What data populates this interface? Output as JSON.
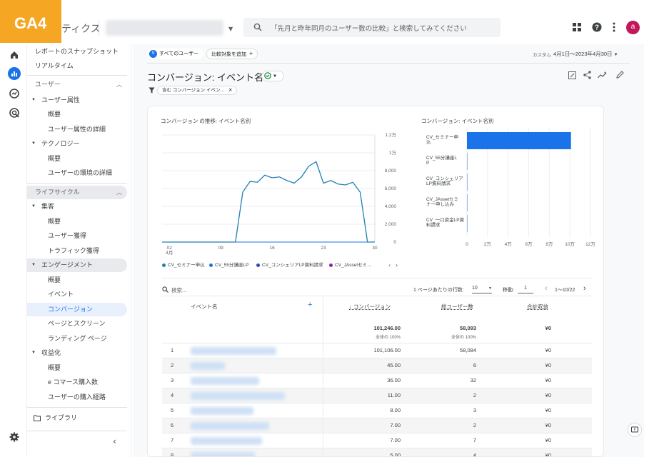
{
  "header": {
    "badge": "GA4",
    "app_title": "ティクス",
    "search_placeholder": "「先月と昨年同月のユーザー数の比較」と検索してみてください",
    "avatar_letter": "a"
  },
  "sidebar": {
    "items": [
      {
        "label": "レポートのスナップショット",
        "type": "item",
        "indent": 0
      },
      {
        "label": "リアルタイム",
        "type": "item",
        "indent": 0
      },
      {
        "label": "ユーザー",
        "type": "section"
      },
      {
        "label": "ユーザー属性",
        "type": "group"
      },
      {
        "label": "概要",
        "type": "item",
        "indent": 2
      },
      {
        "label": "ユーザー属性の詳細",
        "type": "item",
        "indent": 2
      },
      {
        "label": "テクノロジー",
        "type": "group"
      },
      {
        "label": "概要",
        "type": "item",
        "indent": 2
      },
      {
        "label": "ユーザーの環境の詳細",
        "type": "item",
        "indent": 2
      },
      {
        "label": "ライフサイクル",
        "type": "section"
      },
      {
        "label": "集客",
        "type": "group"
      },
      {
        "label": "概要",
        "type": "item",
        "indent": 2
      },
      {
        "label": "ユーザー獲得",
        "type": "item",
        "indent": 2
      },
      {
        "label": "トラフィック獲得",
        "type": "item",
        "indent": 2
      },
      {
        "label": "エンゲージメント",
        "type": "group"
      },
      {
        "label": "概要",
        "type": "item",
        "indent": 2
      },
      {
        "label": "イベント",
        "type": "item",
        "indent": 2
      },
      {
        "label": "コンバージョン",
        "type": "item",
        "indent": 2
      },
      {
        "label": "ページとスクリーン",
        "type": "item",
        "indent": 2
      },
      {
        "label": "ランディング ページ",
        "type": "item",
        "indent": 2
      },
      {
        "label": "収益化",
        "type": "group"
      },
      {
        "label": "概要",
        "type": "item",
        "indent": 2
      },
      {
        "label": "e コマース購入数",
        "type": "item",
        "indent": 2
      },
      {
        "label": "ユーザーの購入経路",
        "type": "item",
        "indent": 2
      }
    ],
    "library": "ライブラリ"
  },
  "filters": {
    "all_users": "すべてのユーザー",
    "add_comparison": "比較対象を追加",
    "date_prefix": "カスタム",
    "date_range": "4月1日～2023年4月30日",
    "filter_chip": "含む コンバージョン イベン…"
  },
  "page": {
    "title": "コンバージョン: イベント名"
  },
  "chart_data": [
    {
      "type": "line",
      "title": "コンバージョン の推移: イベント名別",
      "x_ticks": [
        "02\n4月",
        "09",
        "16",
        "23",
        "30"
      ],
      "y_ticks": [
        "0",
        "2,000",
        "4,000",
        "6,000",
        "8,000",
        "1万",
        "1.2万"
      ],
      "ylim": [
        0,
        12000
      ],
      "x": [
        1,
        2,
        3,
        4,
        5,
        6,
        7,
        8,
        9,
        10,
        11,
        12,
        13,
        14,
        15,
        16,
        17,
        18,
        19,
        20,
        21,
        22,
        23,
        24,
        25,
        26,
        27,
        28,
        29,
        30
      ],
      "series": [
        {
          "name": "CV_セミナー申込",
          "color": "#1f7fb5",
          "values": [
            0,
            0,
            0,
            0,
            0,
            0,
            0,
            0,
            0,
            0,
            0,
            5600,
            6800,
            6700,
            7500,
            7200,
            7300,
            6900,
            6600,
            7300,
            8500,
            9000,
            6600,
            6900,
            6500,
            6400,
            6700,
            5600,
            0,
            0
          ]
        },
        {
          "name": "CV_55分講座LP",
          "color": "#1a73e8",
          "values": [
            0,
            0,
            0,
            0,
            0,
            0,
            0,
            0,
            0,
            0,
            0,
            0,
            0,
            0,
            0,
            0,
            0,
            0,
            0,
            0,
            0,
            0,
            0,
            0,
            0,
            0,
            0,
            0,
            0,
            0
          ]
        },
        {
          "name": "CV_コンシェリアLP資料請求",
          "color": "#3949ab",
          "values": [
            0,
            0,
            0,
            0,
            0,
            0,
            0,
            0,
            0,
            0,
            0,
            0,
            0,
            0,
            0,
            0,
            0,
            0,
            0,
            0,
            0,
            0,
            0,
            0,
            0,
            0,
            0,
            0,
            0,
            0
          ]
        },
        {
          "name": "CV_JAssetセミ…",
          "color": "#8e24aa",
          "values": [
            0,
            0,
            0,
            0,
            0,
            0,
            0,
            0,
            0,
            0,
            0,
            0,
            0,
            0,
            0,
            0,
            0,
            0,
            0,
            0,
            0,
            0,
            0,
            0,
            0,
            0,
            0,
            0,
            0,
            0
          ]
        }
      ]
    },
    {
      "type": "bar",
      "orientation": "horizontal",
      "title": "コンバージョン: イベント名別",
      "categories": [
        "CV_セミナー申込",
        "CV_55分講座LP",
        "CV_コンシェリアLP資料請求",
        "CV_JAssetセミナー申し込み",
        "CV_一口资金LP資料請求"
      ],
      "category_labels": [
        [
          "CV_セミナー申",
          "込"
        ],
        [
          "CV_55分講座L",
          "P"
        ],
        [
          "CV_コンシェリア",
          "LP資料請求"
        ],
        [
          "CV_JAssetセミ",
          "ナー申し込み"
        ],
        [
          "CV_一口资金LP資",
          "料請求"
        ]
      ],
      "values": [
        101106,
        45,
        36,
        11,
        8
      ],
      "x_ticks": [
        "0",
        "2万",
        "4万",
        "6万",
        "8万",
        "10万",
        "12万"
      ],
      "xlim": [
        0,
        120000
      ],
      "color": "#1a73e8"
    }
  ],
  "table": {
    "search_placeholder": "検索...",
    "rows_per_page_label": "1 ページあたりの行数:",
    "rows_per_page": "10",
    "goto_label": "移動:",
    "goto_value": "1",
    "pagination": "1～10/22",
    "columns": [
      "イベント名",
      "↓ コンバージョン",
      "総ユーザー数",
      "合計収益"
    ],
    "totals": {
      "conversions": "101,246.00",
      "users": "58,093",
      "revenue": "¥0",
      "pct_label": "全体の 100%"
    },
    "rows": [
      {
        "idx": "1",
        "conversions": "101,106.00",
        "users": "58,084",
        "revenue": "¥0"
      },
      {
        "idx": "2",
        "conversions": "45.00",
        "users": "6",
        "revenue": "¥0"
      },
      {
        "idx": "3",
        "conversions": "36.00",
        "users": "32",
        "revenue": "¥0"
      },
      {
        "idx": "4",
        "conversions": "11.00",
        "users": "2",
        "revenue": "¥0"
      },
      {
        "idx": "5",
        "conversions": "8.00",
        "users": "3",
        "revenue": "¥0"
      },
      {
        "idx": "6",
        "conversions": "7.00",
        "users": "2",
        "revenue": "¥0"
      },
      {
        "idx": "7",
        "conversions": "7.00",
        "users": "7",
        "revenue": "¥0"
      },
      {
        "idx": "8",
        "conversions": "5.00",
        "users": "4",
        "revenue": "¥0"
      }
    ]
  }
}
